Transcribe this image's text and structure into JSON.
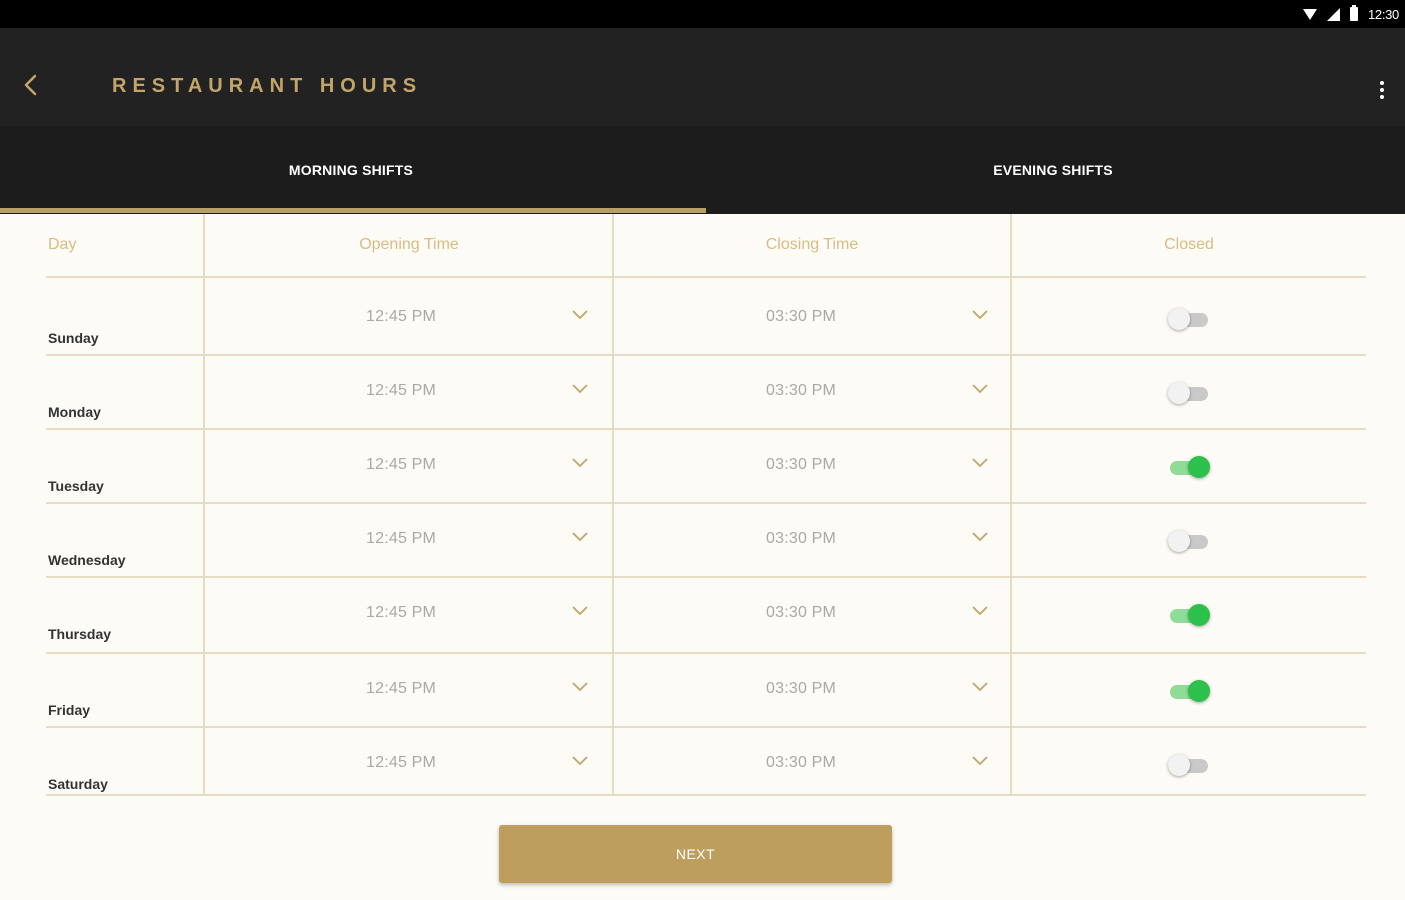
{
  "status_bar": {
    "time": "12:30",
    "icons": [
      "wifi-icon",
      "signal-icon",
      "battery-icon"
    ]
  },
  "app_bar": {
    "title": "RESTAURANT HOURS",
    "back_icon": "chevron-left-icon",
    "menu_icon": "more-vertical-icon",
    "accent_color": "#c4a569"
  },
  "tabs": [
    {
      "label": "MORNING SHIFTS",
      "selected": true
    },
    {
      "label": "EVENING SHIFTS",
      "selected": false
    }
  ],
  "table": {
    "headers": {
      "day": "Day",
      "opening": "Opening Time",
      "closing": "Closing Time",
      "closed": "Closed"
    },
    "rows": [
      {
        "day": "Sunday",
        "opening": "12:45 PM",
        "closing": "03:30 PM",
        "closed": false
      },
      {
        "day": "Monday",
        "opening": "12:45 PM",
        "closing": "03:30 PM",
        "closed": false
      },
      {
        "day": "Tuesday",
        "opening": "12:45 PM",
        "closing": "03:30 PM",
        "closed": true
      },
      {
        "day": "Wednesday",
        "opening": "12:45 PM",
        "closing": "03:30 PM",
        "closed": false
      },
      {
        "day": "Thursday",
        "opening": "12:45 PM",
        "closing": "03:30 PM",
        "closed": true
      },
      {
        "day": "Friday",
        "opening": "12:45 PM",
        "closing": "03:30 PM",
        "closed": true
      },
      {
        "day": "Saturday",
        "opening": "12:45 PM",
        "closing": "03:30 PM",
        "closed": false
      }
    ]
  },
  "next_button": {
    "label": "NEXT",
    "color": "#bd9e5e"
  },
  "colors": {
    "toggle_on": "#2cc14a",
    "toggle_off": "#c9c9c9",
    "header_text": "#d8bc83"
  }
}
